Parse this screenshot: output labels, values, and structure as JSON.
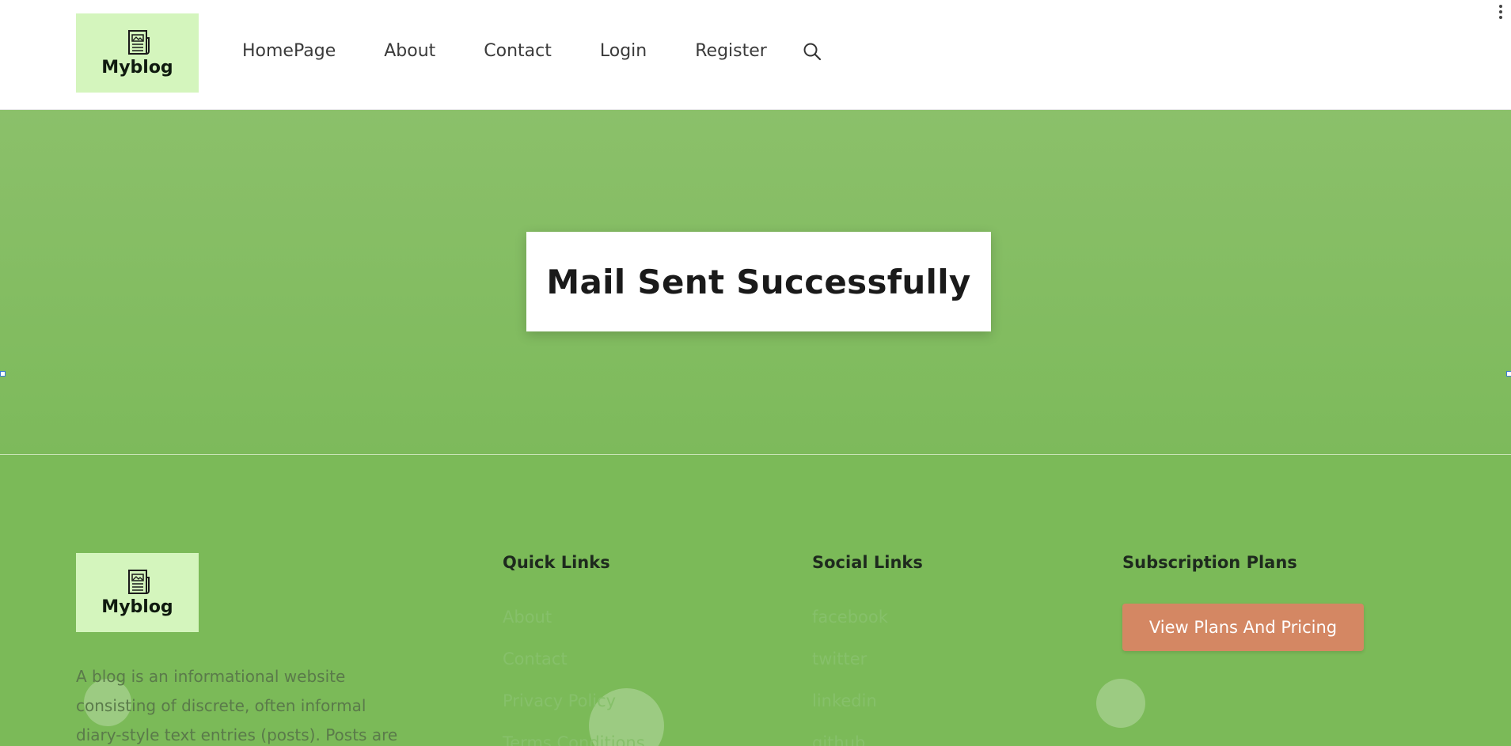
{
  "header": {
    "logo_text": "Myblog",
    "nav": [
      "HomePage",
      "About",
      "Contact",
      "Login",
      "Register"
    ]
  },
  "hero": {
    "message": "Mail Sent Successfully"
  },
  "footer": {
    "logo_text": "Myblog",
    "about_text": "A blog is an informational website consisting of discrete, often informal diary-style text entries (posts). Posts are",
    "quick_links": {
      "title": "Quick Links",
      "items": [
        "About",
        "Contact",
        "Privacy Policy",
        "Terms Conditions"
      ]
    },
    "social_links": {
      "title": "Social Links",
      "items": [
        "facebook",
        "twitter",
        "linkedin",
        "github"
      ]
    },
    "subscription": {
      "title": "Subscription Plans",
      "button_label": "View Plans And Pricing"
    }
  },
  "colors": {
    "logo_bg": "#d4f5bd",
    "hero_bg": "#8bc06a",
    "footer_bg": "#7bba58",
    "button_bg": "#d48763"
  }
}
